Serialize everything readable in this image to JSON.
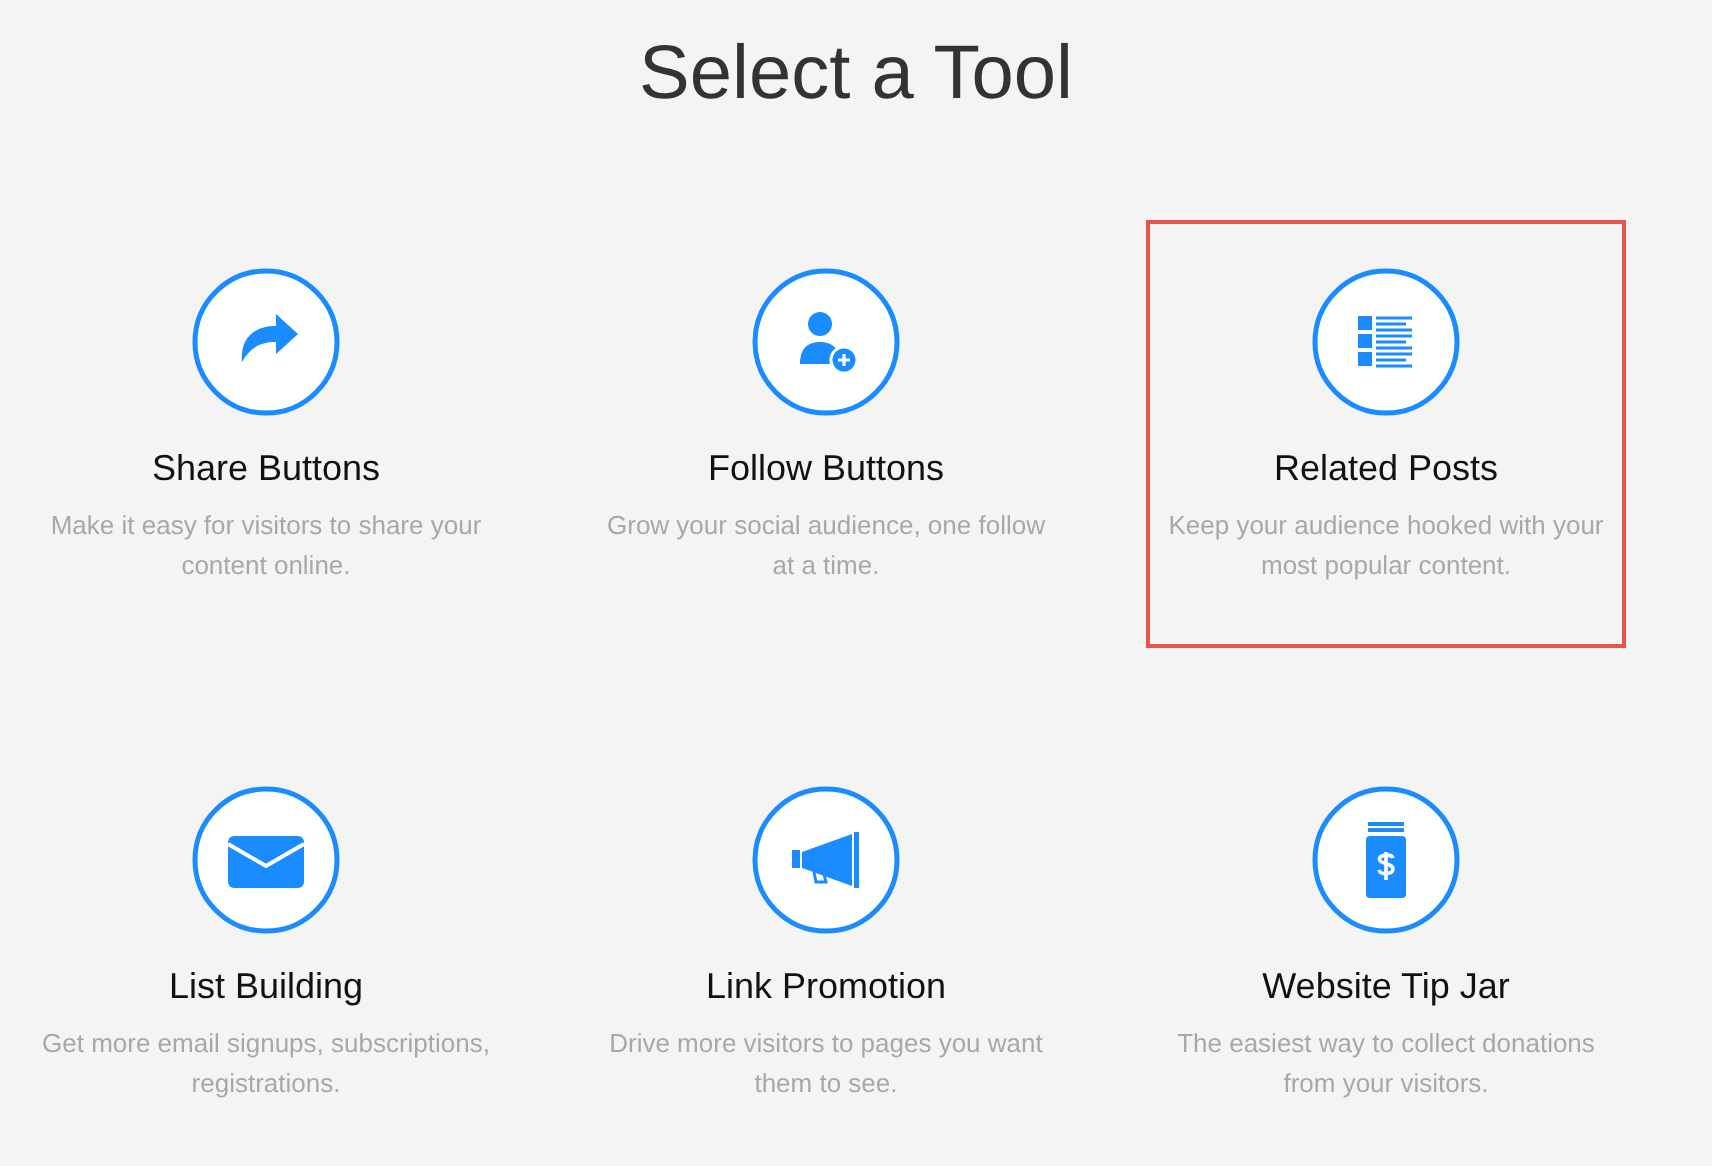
{
  "title": "Select a Tool",
  "tools": [
    {
      "kind": "share",
      "title": "Share Buttons",
      "description": "Make it easy for visitors to share your content online.",
      "selected": false
    },
    {
      "kind": "follow",
      "title": "Follow Buttons",
      "description": "Grow your social audience, one follow at a time.",
      "selected": false
    },
    {
      "kind": "related",
      "title": "Related Posts",
      "description": "Keep your audience hooked with your most popular content.",
      "selected": true
    },
    {
      "kind": "email",
      "title": "List Building",
      "description": "Get more email signups, subscriptions, registrations.",
      "selected": false
    },
    {
      "kind": "promo",
      "title": "Link Promotion",
      "description": "Drive more visitors to pages you want them to see.",
      "selected": false
    },
    {
      "kind": "tipjar",
      "title": "Website Tip Jar",
      "description": "The easiest way to collect donations from your visitors.",
      "selected": false
    }
  ]
}
